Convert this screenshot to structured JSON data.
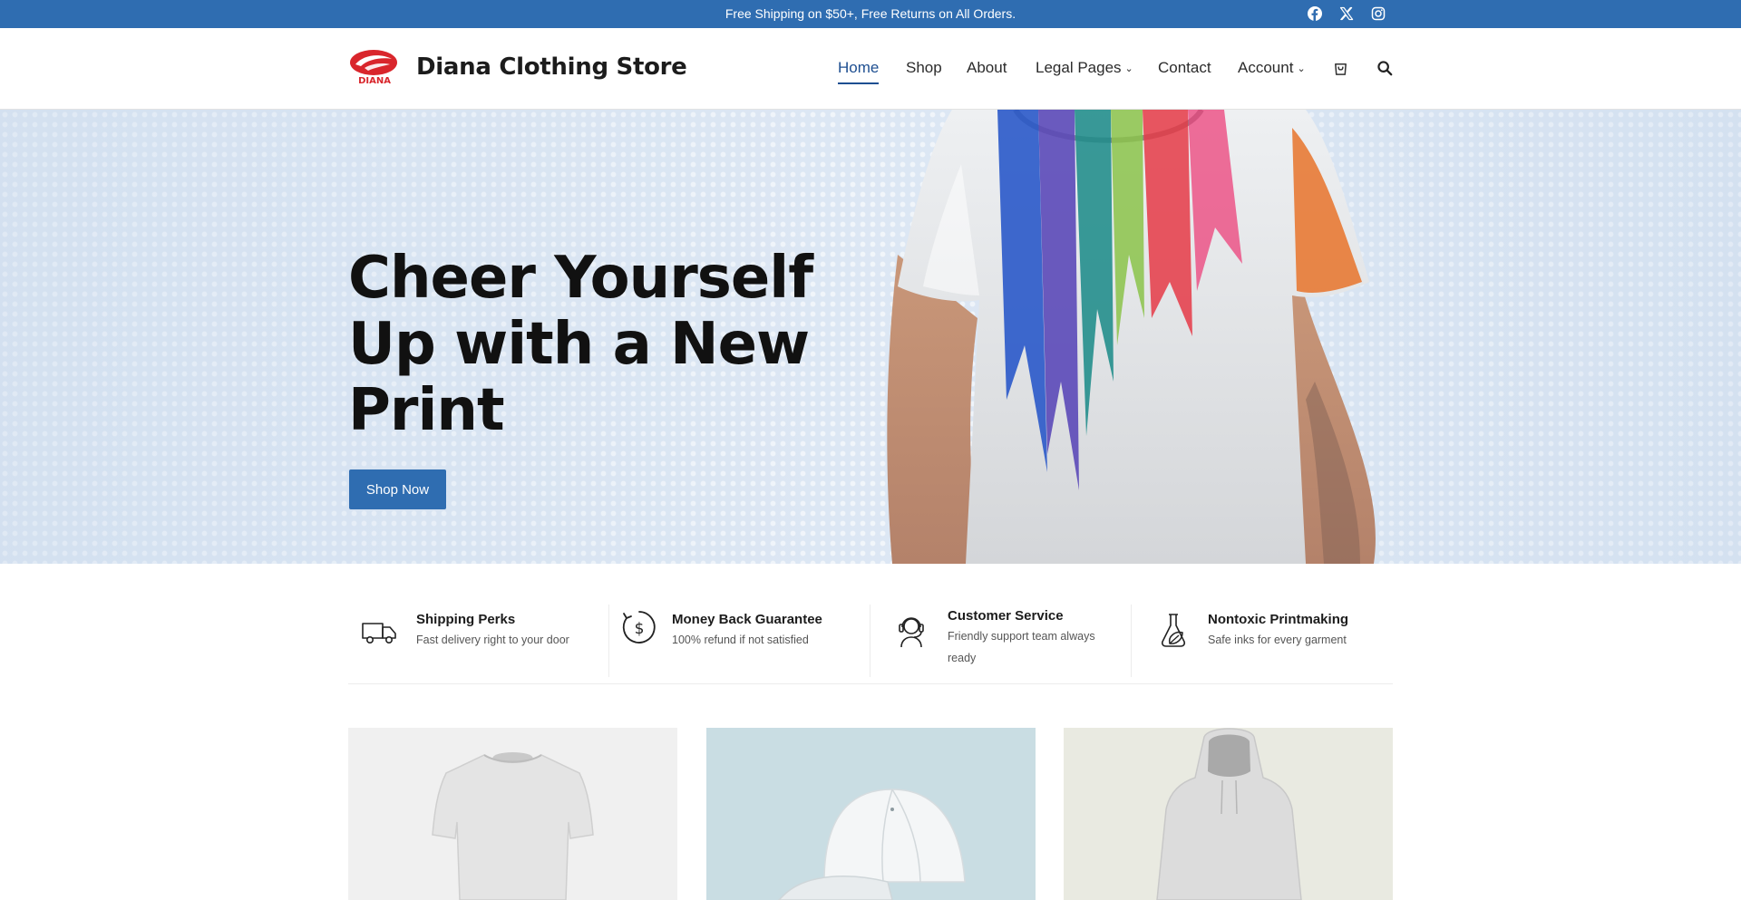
{
  "topbar": {
    "announcement": "Free Shipping on $50+, Free Returns on All Orders.",
    "social_icons": [
      "facebook-icon",
      "x-twitter-icon",
      "instagram-icon"
    ]
  },
  "header": {
    "logo_text": "DIANA",
    "site_title": "Diana Clothing Store",
    "nav": [
      {
        "label": "Home",
        "active": true
      },
      {
        "label": "Shop"
      },
      {
        "label": "About"
      },
      {
        "label": "Legal Pages",
        "has_dropdown": true
      },
      {
        "label": "Contact"
      },
      {
        "label": "Account",
        "has_dropdown": true
      }
    ],
    "icons": [
      "cart-icon",
      "search-icon"
    ]
  },
  "hero": {
    "title": "Cheer Yourself Up with a New Print",
    "button_label": "Shop Now"
  },
  "features": [
    {
      "icon": "delivery-truck-icon",
      "title": "Shipping Perks",
      "description": "Fast delivery right to your door"
    },
    {
      "icon": "money-back-icon",
      "title": "Money Back Guarantee",
      "description": "100% refund if not satisfied"
    },
    {
      "icon": "headset-support-icon",
      "title": "Customer Service",
      "description": "Friendly support team always ready"
    },
    {
      "icon": "flask-leaf-icon",
      "title": "Nontoxic Printmaking",
      "description": "Safe inks for every garment"
    }
  ],
  "products": [
    {
      "image": "white-tshirt",
      "background": "#f0f0f0"
    },
    {
      "image": "white-cap",
      "background": "#c9dde3"
    },
    {
      "image": "white-hoodie",
      "background": "#e9eae1"
    }
  ],
  "colors": {
    "brand_blue": "#2f6db1",
    "active_nav": "#1e4f91",
    "logo_red": "#d9262c"
  }
}
